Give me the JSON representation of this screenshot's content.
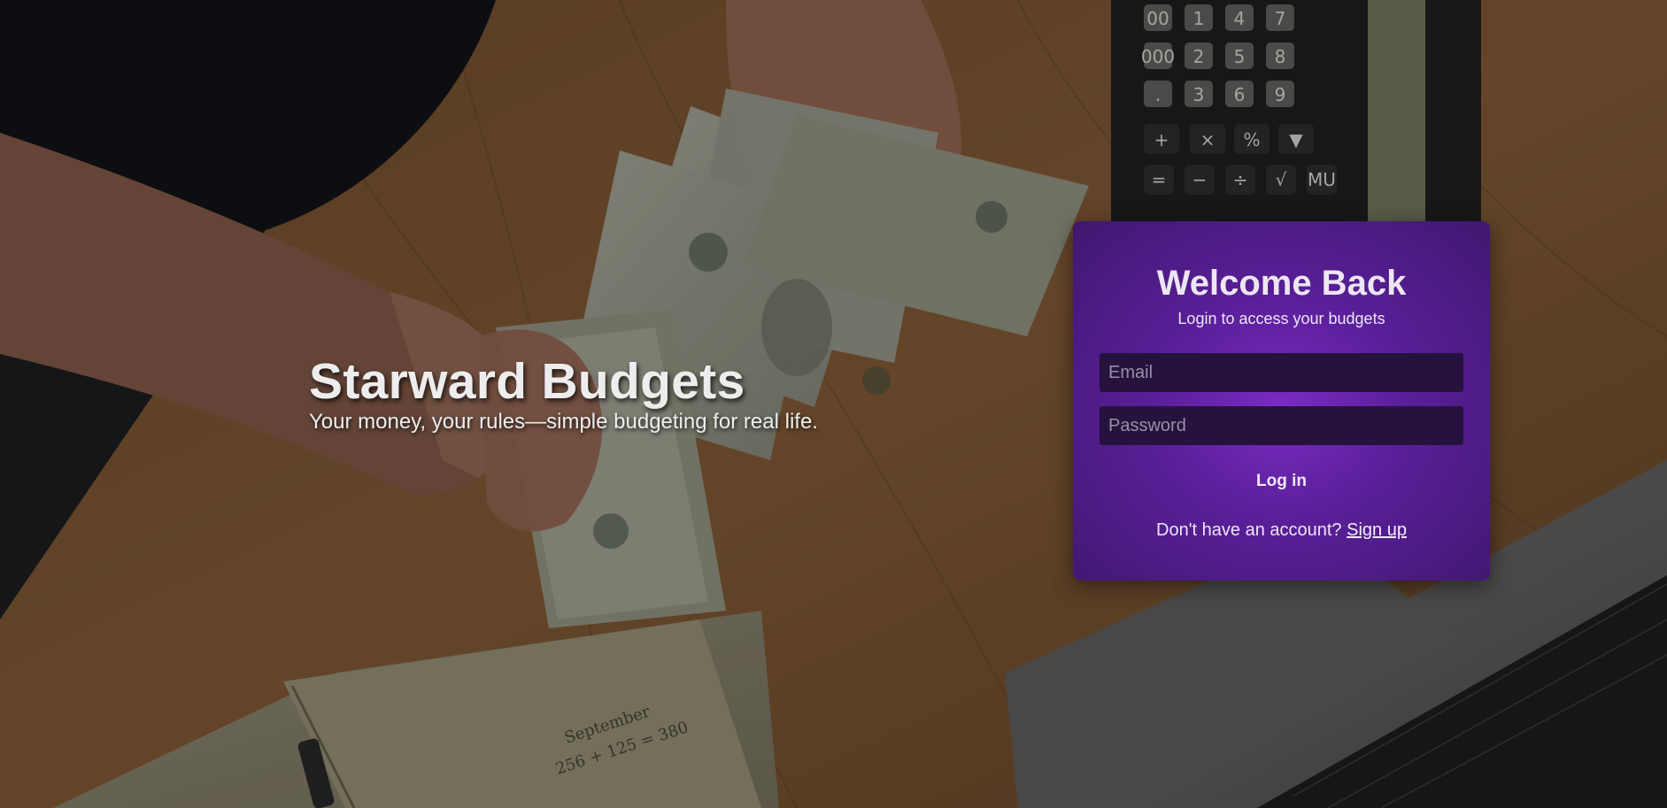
{
  "hero": {
    "title": "Starward Budgets",
    "tagline": "Your money, your rules—simple budgeting for real life."
  },
  "login_card": {
    "title": "Welcome Back",
    "subtitle": "Login to access your budgets",
    "email_placeholder": "Email",
    "password_placeholder": "Password",
    "login_label": "Log in",
    "signup_prompt": "Don't have an account?",
    "signup_label": "Sign up"
  },
  "theme": {
    "card_accent": "#6a24b0",
    "field_background": "#25133d"
  },
  "background": {
    "description_icon": "money-desk-photo",
    "calculator_keys": [
      "00",
      "1",
      "4",
      "7",
      "000",
      "2",
      "5",
      "8",
      ".",
      "3",
      "6",
      "9",
      "+",
      "×",
      "%",
      "▼",
      "=",
      "−",
      "÷",
      "√",
      "MU"
    ]
  }
}
